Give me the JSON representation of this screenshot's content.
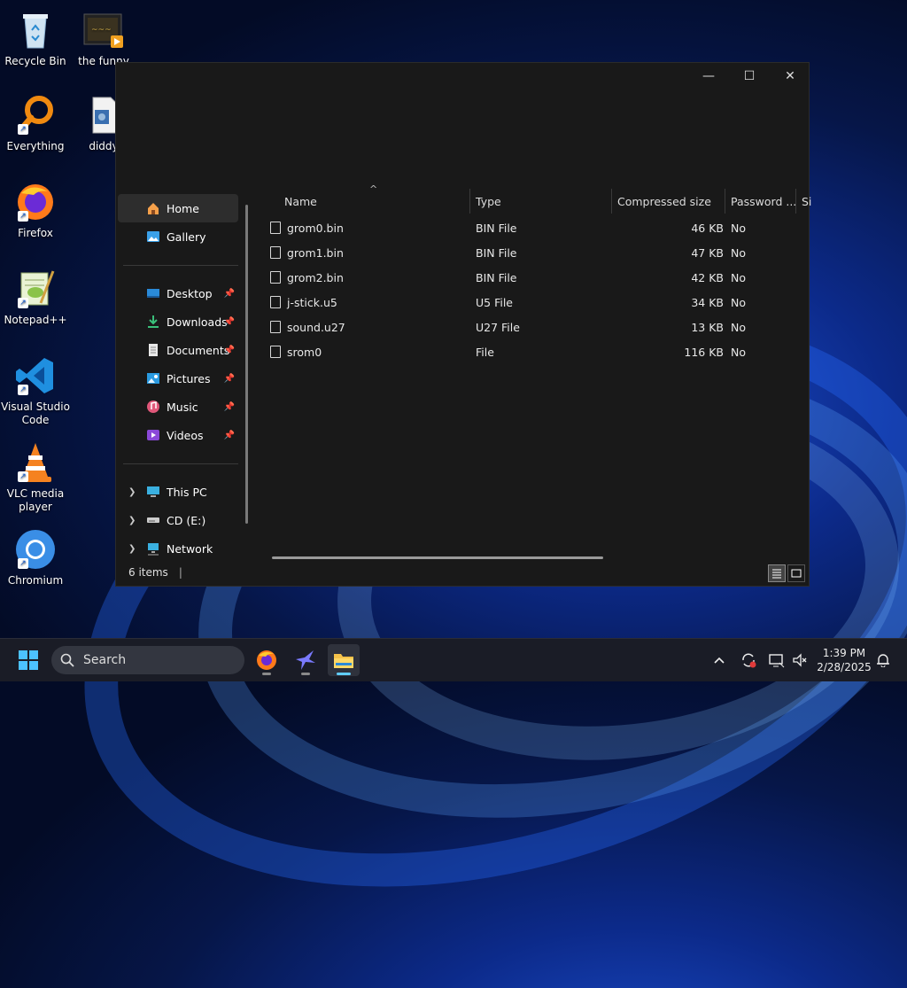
{
  "desktop": {
    "icons": [
      {
        "label": "Recycle Bin",
        "icon": "recycle-bin-icon"
      },
      {
        "label": "the funny",
        "icon": "video-file-icon"
      },
      {
        "label": "Everything",
        "icon": "everything-search-icon"
      },
      {
        "label": "diddy",
        "icon": "audio-file-icon"
      },
      {
        "label": "Firefox",
        "icon": "firefox-icon"
      },
      {
        "label": "Notepad++",
        "icon": "notepad-plus-plus-icon"
      },
      {
        "label": "Visual Studio Code",
        "icon": "vscode-icon"
      },
      {
        "label": "VLC media player",
        "icon": "vlc-icon"
      },
      {
        "label": "Chromium",
        "icon": "chromium-icon"
      }
    ]
  },
  "window": {
    "controls": {
      "minimize": "—",
      "maximize": "☐",
      "close": "✕"
    },
    "nav": {
      "items": [
        {
          "label": "Home",
          "icon": "home-icon",
          "selected": true
        },
        {
          "label": "Gallery",
          "icon": "gallery-icon"
        },
        {
          "label": "Desktop",
          "icon": "desktop-folder-icon",
          "pinned": true
        },
        {
          "label": "Downloads",
          "icon": "downloads-folder-icon",
          "pinned": true
        },
        {
          "label": "Documents",
          "icon": "documents-folder-icon",
          "pinned": true
        },
        {
          "label": "Pictures",
          "icon": "pictures-folder-icon",
          "pinned": true
        },
        {
          "label": "Music",
          "icon": "music-folder-icon",
          "pinned": true
        },
        {
          "label": "Videos",
          "icon": "videos-folder-icon",
          "pinned": true
        },
        {
          "label": "This PC",
          "icon": "this-pc-icon",
          "expandable": true
        },
        {
          "label": "CD (E:)",
          "icon": "cd-drive-icon",
          "expandable": true
        },
        {
          "label": "Network",
          "icon": "network-icon",
          "expandable": true
        }
      ]
    },
    "columns": [
      "Name",
      "Type",
      "Compressed size",
      "Password ...",
      "Si"
    ],
    "sort_indicator": "^",
    "files": [
      {
        "name": "grom0.bin",
        "type": "BIN File",
        "size": "46 KB",
        "password": "No"
      },
      {
        "name": "grom1.bin",
        "type": "BIN File",
        "size": "47 KB",
        "password": "No"
      },
      {
        "name": "grom2.bin",
        "type": "BIN File",
        "size": "42 KB",
        "password": "No"
      },
      {
        "name": "j-stick.u5",
        "type": "U5 File",
        "size": "34 KB",
        "password": "No"
      },
      {
        "name": "sound.u27",
        "type": "U27 File",
        "size": "13 KB",
        "password": "No"
      },
      {
        "name": "srom0",
        "type": "File",
        "size": "116 KB",
        "password": "No"
      }
    ],
    "status": {
      "count": "6 items",
      "divider": "|"
    }
  },
  "taskbar": {
    "search_placeholder": "Search",
    "apps": [
      {
        "name": "firefox",
        "icon": "firefox-icon"
      },
      {
        "name": "app",
        "icon": "bird-app-icon"
      },
      {
        "name": "file-explorer",
        "icon": "file-explorer-icon",
        "active": true
      }
    ],
    "clock": {
      "time": "1:39 PM",
      "date": "2/28/2025"
    }
  },
  "colors": {
    "accent": "#60cdff",
    "window_bg": "#191919",
    "taskbar_bg": "#1a1c26"
  }
}
